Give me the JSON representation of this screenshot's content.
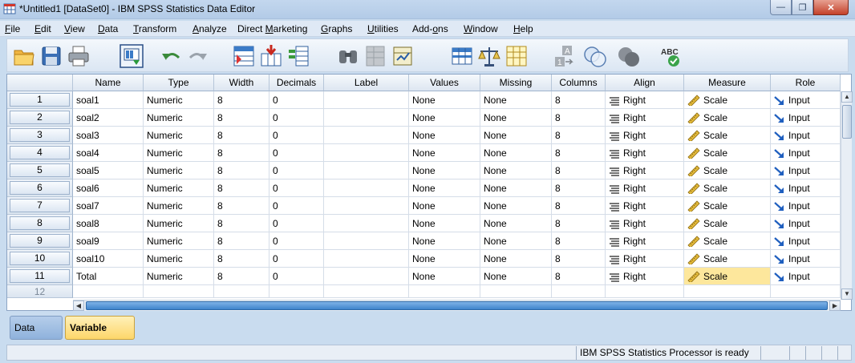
{
  "window": {
    "title": "*Untitled1 [DataSet0] - IBM SPSS Statistics Data Editor",
    "minimize_icon": "minimize-icon",
    "maximize_icon": "restore-icon",
    "close_icon": "close-icon"
  },
  "menu": [
    {
      "label": "File",
      "u": "F",
      "rest": "ile"
    },
    {
      "label": "Edit",
      "u": "E",
      "rest": "dit"
    },
    {
      "label": "View",
      "u": "V",
      "rest": "iew"
    },
    {
      "label": "Data",
      "u": "D",
      "rest": "ata"
    },
    {
      "label": "Transform",
      "u": "T",
      "rest": "ransform"
    },
    {
      "label": "Analyze",
      "u": "A",
      "rest": "nalyze"
    },
    {
      "label": "Direct Marketing",
      "pre": "Direct ",
      "u": "M",
      "rest": "arketing"
    },
    {
      "label": "Graphs",
      "u": "G",
      "rest": "raphs"
    },
    {
      "label": "Utilities",
      "u": "U",
      "rest": "tilities"
    },
    {
      "label": "Add-ons",
      "pre": "Add-",
      "u": "o",
      "rest": "ns"
    },
    {
      "label": "Window",
      "u": "W",
      "rest": "indow"
    },
    {
      "label": "Help",
      "u": "H",
      "rest": "elp"
    }
  ],
  "toolbar_icons": [
    "open-folder-icon",
    "save-icon",
    "print-icon",
    "dialog-recall-icon",
    "undo-icon",
    "redo-icon",
    "goto-case-icon",
    "goto-variable-icon",
    "variables-icon",
    "find-icon",
    "insert-cases-icon",
    "insert-variable-icon",
    "split-file-icon",
    "weight-cases-icon",
    "select-cases-icon",
    "value-labels-icon",
    "use-variable-sets-icon",
    "show-all-variables-icon",
    "spell-check-icon"
  ],
  "columns": [
    "Name",
    "Type",
    "Width",
    "Decimals",
    "Label",
    "Values",
    "Missing",
    "Columns",
    "Align",
    "Measure",
    "Role"
  ],
  "rows": [
    {
      "num": "1",
      "name": "soal1",
      "type": "Numeric",
      "width": "8",
      "decimals": "0",
      "label": "",
      "values": "None",
      "missing": "None",
      "columns": "8",
      "align": "Right",
      "measure": "Scale",
      "role": "Input"
    },
    {
      "num": "2",
      "name": "soal2",
      "type": "Numeric",
      "width": "8",
      "decimals": "0",
      "label": "",
      "values": "None",
      "missing": "None",
      "columns": "8",
      "align": "Right",
      "measure": "Scale",
      "role": "Input"
    },
    {
      "num": "3",
      "name": "soal3",
      "type": "Numeric",
      "width": "8",
      "decimals": "0",
      "label": "",
      "values": "None",
      "missing": "None",
      "columns": "8",
      "align": "Right",
      "measure": "Scale",
      "role": "Input"
    },
    {
      "num": "4",
      "name": "soal4",
      "type": "Numeric",
      "width": "8",
      "decimals": "0",
      "label": "",
      "values": "None",
      "missing": "None",
      "columns": "8",
      "align": "Right",
      "measure": "Scale",
      "role": "Input"
    },
    {
      "num": "5",
      "name": "soal5",
      "type": "Numeric",
      "width": "8",
      "decimals": "0",
      "label": "",
      "values": "None",
      "missing": "None",
      "columns": "8",
      "align": "Right",
      "measure": "Scale",
      "role": "Input"
    },
    {
      "num": "6",
      "name": "soal6",
      "type": "Numeric",
      "width": "8",
      "decimals": "0",
      "label": "",
      "values": "None",
      "missing": "None",
      "columns": "8",
      "align": "Right",
      "measure": "Scale",
      "role": "Input"
    },
    {
      "num": "7",
      "name": "soal7",
      "type": "Numeric",
      "width": "8",
      "decimals": "0",
      "label": "",
      "values": "None",
      "missing": "None",
      "columns": "8",
      "align": "Right",
      "measure": "Scale",
      "role": "Input"
    },
    {
      "num": "8",
      "name": "soal8",
      "type": "Numeric",
      "width": "8",
      "decimals": "0",
      "label": "",
      "values": "None",
      "missing": "None",
      "columns": "8",
      "align": "Right",
      "measure": "Scale",
      "role": "Input"
    },
    {
      "num": "9",
      "name": "soal9",
      "type": "Numeric",
      "width": "8",
      "decimals": "0",
      "label": "",
      "values": "None",
      "missing": "None",
      "columns": "8",
      "align": "Right",
      "measure": "Scale",
      "role": "Input"
    },
    {
      "num": "10",
      "name": "soal10",
      "type": "Numeric",
      "width": "8",
      "decimals": "0",
      "label": "",
      "values": "None",
      "missing": "None",
      "columns": "8",
      "align": "Right",
      "measure": "Scale",
      "role": "Input"
    },
    {
      "num": "11",
      "name": "Total",
      "type": "Numeric",
      "width": "8",
      "decimals": "0",
      "label": "",
      "values": "None",
      "missing": "None",
      "columns": "8",
      "align": "Right",
      "measure": "Scale",
      "role": "Input"
    }
  ],
  "empty_row_num": "12",
  "tabs": {
    "data_view": "Data View",
    "variable_view": "Variable View"
  },
  "status": {
    "processor": "IBM SPSS Statistics Processor is ready"
  },
  "colors": {
    "selected_cell": "#fde79c",
    "active_tab": "#fdd66a"
  }
}
